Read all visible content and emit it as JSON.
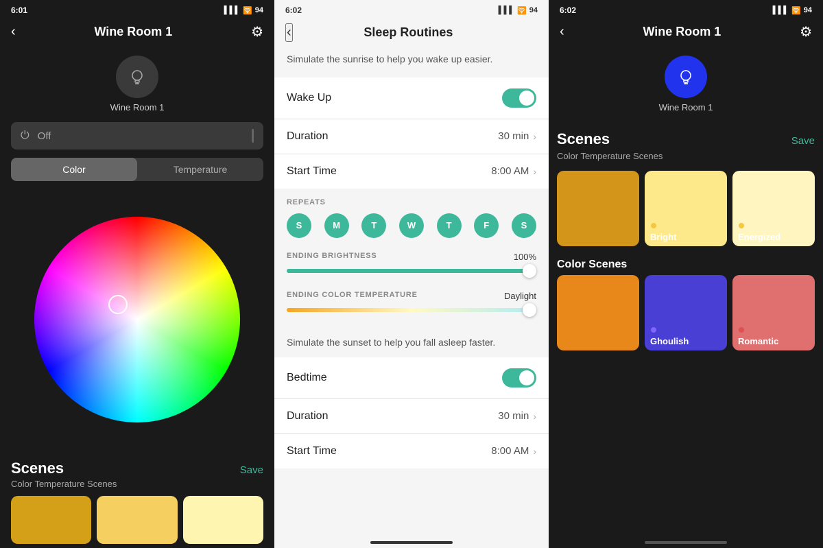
{
  "left": {
    "status": {
      "time": "6:01",
      "battery": "94"
    },
    "header": {
      "title": "Wine Room 1",
      "back": "‹",
      "settings": "⚙"
    },
    "device": {
      "label": "Wine Room 1",
      "icon": "💡"
    },
    "power": {
      "label": "Off"
    },
    "tabs": [
      {
        "id": "color",
        "label": "Color",
        "active": true
      },
      {
        "id": "temperature",
        "label": "Temperature",
        "active": false
      }
    ],
    "scenes": {
      "title": "Scenes",
      "save_label": "Save",
      "subtitle": "Color Temperature Scenes"
    }
  },
  "middle": {
    "status": {
      "time": "6:02",
      "battery": "94"
    },
    "header": {
      "title": "Sleep Routines",
      "back": "‹"
    },
    "wakeup_desc": "Simulate the sunrise to help you wake up easier.",
    "wakeup_label": "Wake Up",
    "duration_label": "Duration",
    "duration_value": "30 min",
    "start_time_label": "Start Time",
    "start_time_value": "8:00 AM",
    "repeats_label": "REPEATS",
    "days": [
      "S",
      "M",
      "T",
      "W",
      "T",
      "F",
      "S"
    ],
    "ending_brightness_label": "ENDING BRIGHTNESS",
    "ending_brightness_value": "100%",
    "ending_color_temp_label": "ENDING COLOR TEMPERATURE",
    "ending_color_temp_value": "Daylight",
    "sunset_desc": "Simulate the sunset to help you fall asleep faster.",
    "bedtime_label": "Bedtime",
    "bedtime_duration_label": "Duration",
    "bedtime_duration_value": "30 min",
    "bedtime_start_label": "Start Time",
    "bedtime_start_value": "8:00 AM"
  },
  "right": {
    "status": {
      "time": "6:02",
      "battery": "94"
    },
    "header": {
      "title": "Wine Room 1",
      "back": "‹",
      "settings": "⚙"
    },
    "device": {
      "label": "Wine Room 1",
      "icon": "💡"
    },
    "scenes": {
      "title": "Scenes",
      "save_label": "Save",
      "temp_subtitle": "Color Temperature Scenes",
      "color_subtitle": "Color Scenes"
    },
    "temp_scenes": [
      {
        "id": "warm",
        "color": "#f5c842",
        "label": "",
        "dot": ""
      },
      {
        "id": "bright",
        "color": "#fde98a",
        "label": "Bright",
        "dot": "#f5c842"
      },
      {
        "id": "energized",
        "color": "#fef5c0",
        "label": "Energized",
        "dot": "#f5c842"
      }
    ],
    "color_scenes": [
      {
        "id": "orange",
        "color": "#e8871a",
        "label": "",
        "dot": ""
      },
      {
        "id": "ghoulish",
        "color": "#4a3fd4",
        "label": "Ghoulish",
        "dot": "#8066ff"
      },
      {
        "id": "romantic",
        "color": "#e07070",
        "label": "Romantic",
        "dot": "#e05050"
      }
    ]
  }
}
